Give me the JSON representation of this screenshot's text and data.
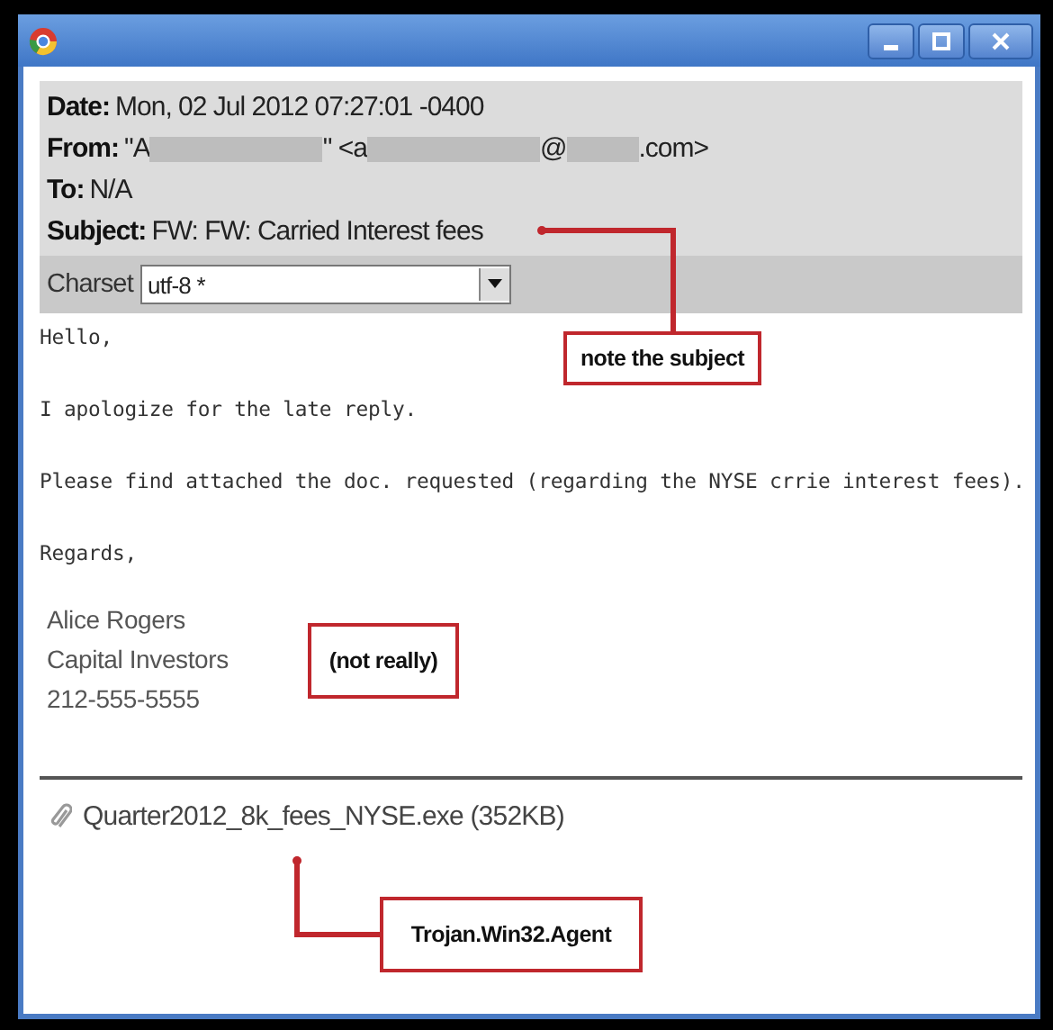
{
  "headers": [
    {
      "label": "Date:",
      "parts": [
        {
          "kind": "text",
          "text": "Mon, 02 Jul 2012 07:27:01 -0400"
        }
      ]
    },
    {
      "label": "From:",
      "parts": [
        {
          "kind": "text",
          "text": "\"A"
        },
        {
          "kind": "redacted"
        },
        {
          "kind": "text",
          "text": "\" <a"
        },
        {
          "kind": "redacted"
        },
        {
          "kind": "text",
          "text": "@"
        },
        {
          "kind": "redacted"
        },
        {
          "kind": "text",
          "text": ".com>"
        }
      ]
    },
    {
      "label": "To:",
      "parts": [
        {
          "kind": "text",
          "text": "N/A"
        }
      ]
    },
    {
      "label": "Subject:",
      "parts": [
        {
          "kind": "text",
          "text": "FW: FW: Carried Interest fees"
        }
      ]
    }
  ],
  "charset": {
    "label": "Charset",
    "value": "utf-8 *"
  },
  "body": [
    "Hello,",
    "I apologize for the late reply.",
    "Please find attached the doc. requested (regarding the NYSE crrie interest fees).",
    "Regards,"
  ],
  "signature": [
    "Alice Rogers",
    "Capital Investors",
    "212-555-5555"
  ],
  "attachment": {
    "name": "Quarter2012_8k_fees_NYSE.exe (352KB)"
  },
  "annotations": [
    {
      "text": "note the subject"
    },
    {
      "text": "(not really)"
    },
    {
      "text": "Trojan.Win32.Agent"
    }
  ]
}
